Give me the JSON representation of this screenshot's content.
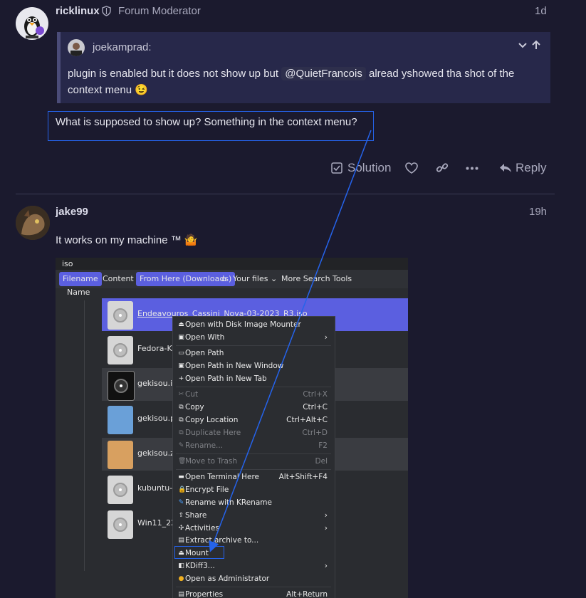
{
  "post1": {
    "username": "ricklinux",
    "role": "Forum Moderator",
    "date": "1d",
    "quote": {
      "author": "joekamprad:",
      "text_before": "plugin is enabled but it does not show up but ",
      "mention": "@QuietFrancois",
      "text_after": " alread yshowed tha shot of the",
      "line2": "context menu",
      "emoji": "😉"
    },
    "body": "What is supposed to show up? Something in the context menu?",
    "actions": {
      "solution": "Solution",
      "reply": "Reply"
    }
  },
  "post2": {
    "username": "jake99",
    "date": "19h",
    "body": "It works on my machine ™",
    "emoji": "🤷"
  },
  "screenshot": {
    "window_title": "iso",
    "tabs": [
      "Filename",
      "Content",
      "From Here (Downloads)",
      "Your files",
      "More Search Tools"
    ],
    "column_header": "Name",
    "files": [
      "Endeavouros_Cassini_Nova-03-2023_R3.iso",
      "Fedora-KD",
      "gekisou.icc",
      "gekisou.pn",
      "gekisou.zip",
      "kubuntu-2",
      "Win11_22H"
    ],
    "context_menu": [
      {
        "label": "Open with Disk Image Mounter",
        "shortcut": "",
        "icon": "⏏"
      },
      {
        "label": "Open With",
        "shortcut": "›",
        "icon": "▣"
      },
      {
        "label": "Open Path",
        "shortcut": "",
        "icon": "▭"
      },
      {
        "label": "Open Path in New Window",
        "shortcut": "",
        "icon": "▣"
      },
      {
        "label": "Open Path in New Tab",
        "shortcut": "",
        "icon": "+"
      },
      {
        "label": "Cut",
        "shortcut": "Ctrl+X",
        "icon": "✂"
      },
      {
        "label": "Copy",
        "shortcut": "Ctrl+C",
        "icon": "⧉"
      },
      {
        "label": "Copy Location",
        "shortcut": "Ctrl+Alt+C",
        "icon": "⧉"
      },
      {
        "label": "Duplicate Here",
        "shortcut": "Ctrl+D",
        "icon": "⧉"
      },
      {
        "label": "Rename...",
        "shortcut": "F2",
        "icon": "✎"
      },
      {
        "label": "Move to Trash",
        "shortcut": "Del",
        "icon": "🗑"
      },
      {
        "label": "Open Terminal Here",
        "shortcut": "Alt+Shift+F4",
        "icon": "▬"
      },
      {
        "label": "Encrypt File",
        "shortcut": "",
        "icon": "🔒"
      },
      {
        "label": "Rename with KRename",
        "shortcut": "",
        "icon": "✎"
      },
      {
        "label": "Share",
        "shortcut": "›",
        "icon": "⇪"
      },
      {
        "label": "Activities",
        "shortcut": "›",
        "icon": "✣"
      },
      {
        "label": "Extract archive to...",
        "shortcut": "",
        "icon": "▤"
      },
      {
        "label": "Mount",
        "shortcut": "",
        "icon": "⏏"
      },
      {
        "label": "KDiff3...",
        "shortcut": "›",
        "icon": "◧"
      },
      {
        "label": "Open as Administrator",
        "shortcut": "",
        "icon": "●"
      },
      {
        "label": "Properties",
        "shortcut": "Alt+Return",
        "icon": "▤"
      }
    ]
  },
  "colors": {
    "accent": "#2563eb",
    "selection": "#5b5fe0",
    "background": "#1b1a2e"
  }
}
